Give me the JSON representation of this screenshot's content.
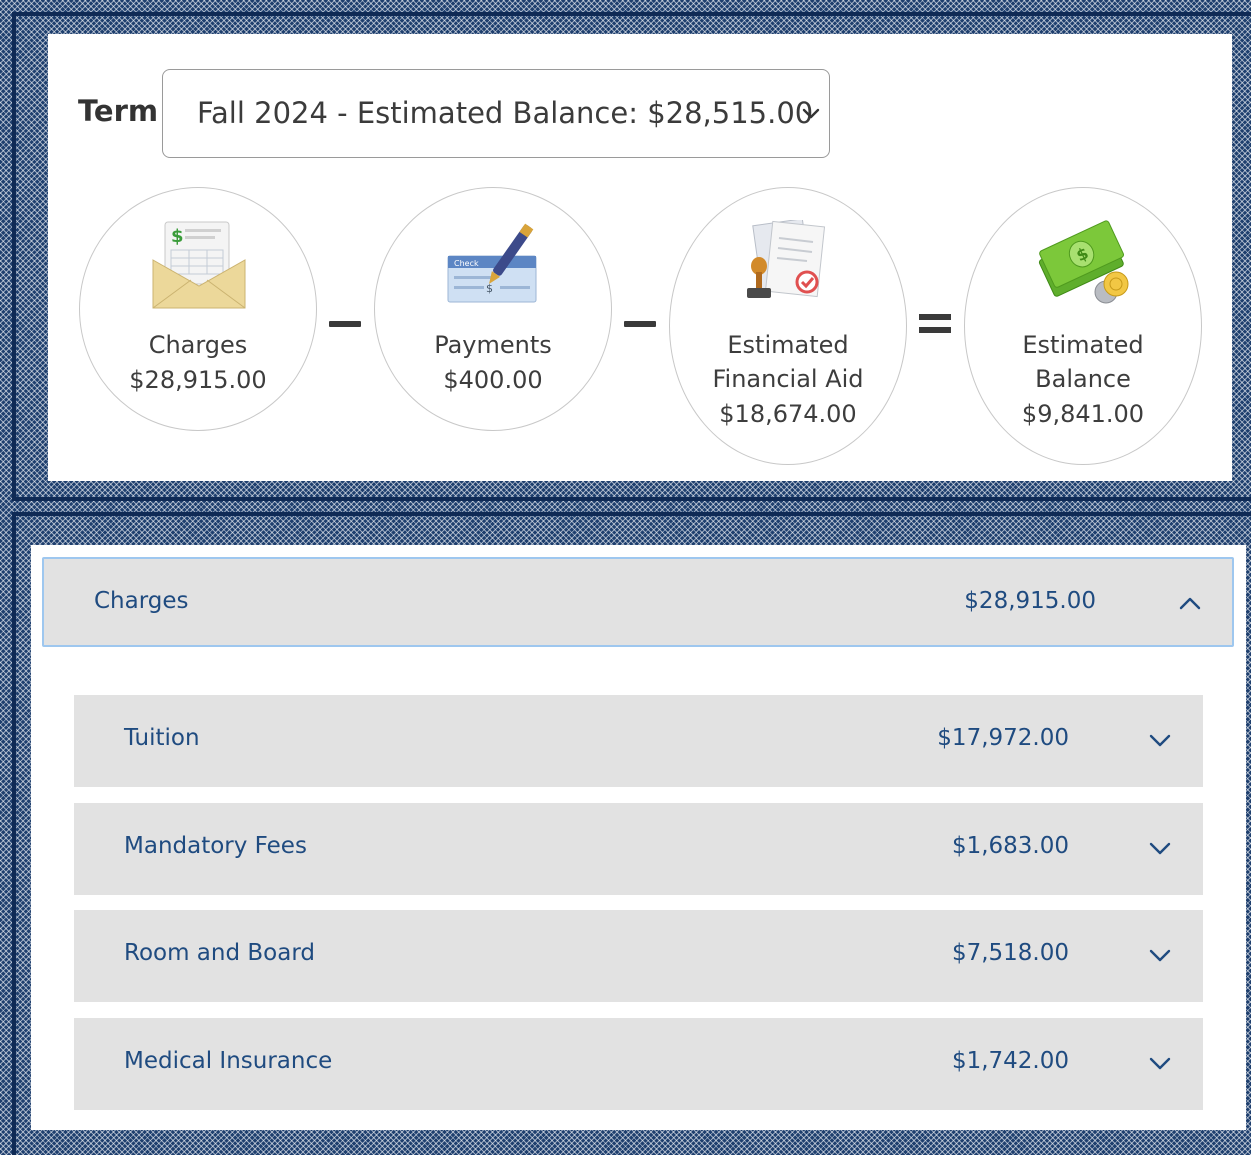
{
  "term": {
    "label": "Term",
    "selected": "Fall 2024 - Estimated Balance: $28,515.00",
    "chevron_icon": "chevron-down-icon"
  },
  "summary": {
    "charges": {
      "label": "Charges",
      "amount": "$28,915.00",
      "icon": "envelope-bill-icon"
    },
    "payments": {
      "label": "Payments",
      "amount": "$400.00",
      "icon": "check-pen-icon"
    },
    "aid": {
      "label_line1": "Estimated",
      "label_line2": "Financial Aid",
      "amount": "$18,674.00",
      "icon": "documents-stamp-icon"
    },
    "balance": {
      "label_line1": "Estimated",
      "label_line2": "Balance",
      "amount": "$9,841.00",
      "icon": "money-coins-icon"
    },
    "operators": [
      "minus",
      "minus",
      "equals"
    ]
  },
  "charges_section": {
    "title": "Charges",
    "amount": "$28,915.00",
    "expanded": true,
    "items": [
      {
        "title": "Tuition",
        "amount": "$17,972.00"
      },
      {
        "title": "Mandatory Fees",
        "amount": "$1,683.00"
      },
      {
        "title": "Room and Board",
        "amount": "$7,518.00"
      },
      {
        "title": "Medical Insurance",
        "amount": "$1,742.00"
      }
    ]
  },
  "colors": {
    "link_blue": "#1f4b80",
    "header_gray": "#e2e2e2",
    "focus_border": "#9ec7ef",
    "background_navy": "#1e3f6e"
  }
}
